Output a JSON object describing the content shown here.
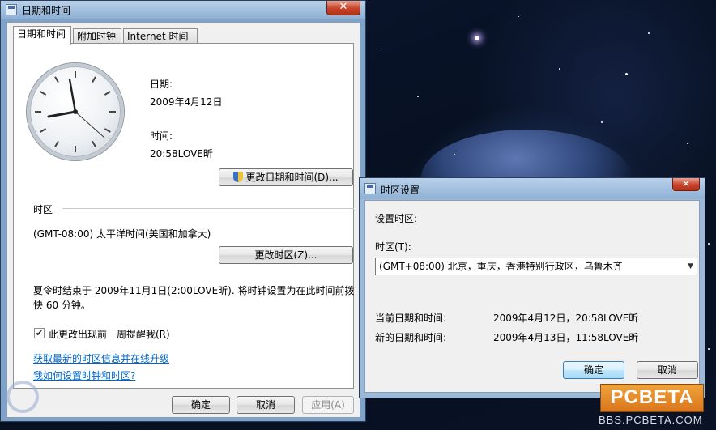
{
  "main_window": {
    "title": "日期和时间",
    "close": "✕",
    "tabs": [
      "日期和时间",
      "附加时钟",
      "Internet 时间"
    ],
    "date_label": "日期:",
    "date_value": "2009年4月12日",
    "time_label": "时间:",
    "time_value": "20:58LOVE昕",
    "change_datetime_button": "更改日期和时间(D)...",
    "timezone_section": "时区",
    "timezone_value": "(GMT-08:00) 太平洋时间(美国和加拿大)",
    "change_timezone_button": "更改时区(Z)...",
    "dst_text_line1": "夏令时结束于 2009年11月1日(2:00LOVE昕). 将时钟设置为在此时间前拨",
    "dst_text_line2": "快 60 分钟。",
    "dst_checkbox_label": "此更改出现前一周提醒我(R)",
    "dst_checkbox_checked": true,
    "link_update": "获取最新的时区信息并在线升级",
    "link_howto": "我如何设置时钟和时区?",
    "ok_button": "确定",
    "cancel_button": "取消",
    "apply_button": "应用(A)"
  },
  "timezone_dialog": {
    "title": "时区设置",
    "close": "✕",
    "heading": "设置时区:",
    "zone_label": "时区(T):",
    "zone_selected": "(GMT+08:00) 北京，重庆，香港特别行政区，乌鲁木齐",
    "current_label": "当前日期和时间:",
    "current_value": "2009年4月12日，20:58LOVE昕",
    "new_label": "新的日期和时间:",
    "new_value": "2009年4月13日，11:58LOVE昕",
    "ok_button": "确定",
    "cancel_button": "取消"
  },
  "watermarks": {
    "brand": "PCBETA",
    "url": "BBS.PCBETA.COM"
  }
}
